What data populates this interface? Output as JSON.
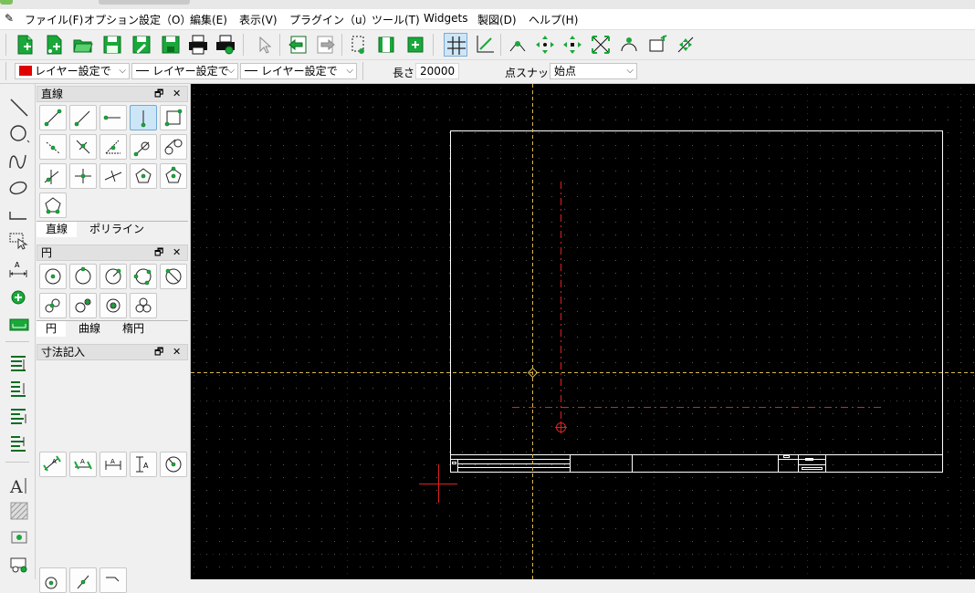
{
  "menubar": {
    "items": [
      {
        "label": "ファイル(F)"
      },
      {
        "label": "オプション設定（O）"
      },
      {
        "label": "編集(E)"
      },
      {
        "label": "表示(V)"
      },
      {
        "label": "プラグイン（u）"
      },
      {
        "label": "ツール(T)"
      },
      {
        "label": "Widgets"
      },
      {
        "label": "製図(D)"
      },
      {
        "label": "ヘルプ(H)"
      }
    ]
  },
  "toolbar2": {
    "color_combo": "レイヤー設定で",
    "linetype_combo": "レイヤー設定で",
    "linewidth_combo": "レイヤー設定で",
    "length_label": "長さ:",
    "length_value": "20000",
    "snap_label": "点スナップ:",
    "snap_value": "始点",
    "accent_color": "#e00000"
  },
  "panels": {
    "line": {
      "title": "直線",
      "tabs": [
        {
          "label": "直線"
        },
        {
          "label": "ポリライン"
        }
      ]
    },
    "circle": {
      "title": "円",
      "tabs": [
        {
          "label": "円"
        },
        {
          "label": "曲線"
        },
        {
          "label": "楕円"
        }
      ]
    },
    "dimension": {
      "title": "寸法記入"
    },
    "float_glyph": "🗗",
    "close_glyph": "✕"
  },
  "canvas": {
    "background": "#000000",
    "grid_color": "#555555",
    "crosshair_color": "#d9b84a",
    "marker_color": "#e02020"
  }
}
